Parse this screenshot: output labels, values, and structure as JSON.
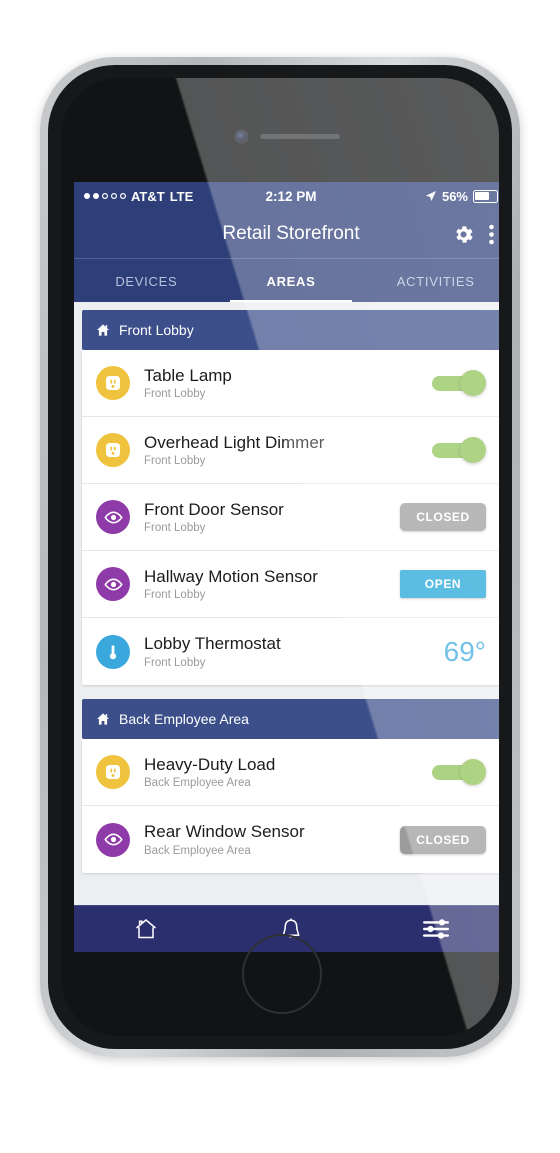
{
  "status_bar": {
    "carrier": "AT&T",
    "network": "LTE",
    "time": "2:12 PM",
    "battery_percent": "56%",
    "signal_filled_dots": 2,
    "signal_hollow_dots": 3,
    "location_icon": "location-arrow-icon",
    "battery_icon": "battery-icon"
  },
  "header": {
    "title": "Retail Storefront",
    "settings_icon": "gear-icon",
    "overflow_icon": "three-dot-menu-icon"
  },
  "tabs": [
    {
      "label": "DEVICES",
      "active": false
    },
    {
      "label": "AREAS",
      "active": true
    },
    {
      "label": "ACTIVITIES",
      "active": false
    }
  ],
  "sections": [
    {
      "title": "Front Lobby",
      "icon": "home-icon",
      "rows": [
        {
          "name": "Table Lamp",
          "area": "Front Lobby",
          "icon": "outlet-icon",
          "icon_color": "#efc33d",
          "control": "toggle",
          "value": "on"
        },
        {
          "name": "Overhead Light Dimmer",
          "area": "Front Lobby",
          "icon": "outlet-icon",
          "icon_color": "#efc33d",
          "control": "toggle",
          "value": "on"
        },
        {
          "name": "Front Door Sensor",
          "area": "Front Lobby",
          "icon": "eye-icon",
          "icon_color": "#8e3aa8",
          "control": "badge-closed",
          "value": "CLOSED"
        },
        {
          "name": "Hallway Motion Sensor",
          "area": "Front Lobby",
          "icon": "eye-icon",
          "icon_color": "#8e3aa8",
          "control": "badge-open",
          "value": "OPEN"
        },
        {
          "name": "Lobby Thermostat",
          "area": "Front Lobby",
          "icon": "thermometer-icon",
          "icon_color": "#3ba8dd",
          "control": "temperature",
          "value": "69°"
        }
      ]
    },
    {
      "title": "Back Employee Area",
      "icon": "home-icon",
      "rows": [
        {
          "name": "Heavy-Duty Load",
          "area": "Back Employee Area",
          "icon": "outlet-icon",
          "icon_color": "#efc33d",
          "control": "toggle",
          "value": "on"
        },
        {
          "name": "Rear Window Sensor",
          "area": "Back Employee Area",
          "icon": "eye-icon",
          "icon_color": "#8e3aa8",
          "control": "badge-closed",
          "value": "CLOSED"
        }
      ]
    }
  ],
  "bottom_nav": [
    {
      "icon": "home-outline-icon"
    },
    {
      "icon": "bell-icon"
    },
    {
      "icon": "sliders-icon"
    }
  ],
  "colors": {
    "header_blue": "#2d3e78",
    "section_blue": "#3c4f8a",
    "toggle_green": "#8cc152",
    "open_blue": "#1ba3d6",
    "closed_gray": "#9b9b9b",
    "temp_blue": "#3ba8dd"
  }
}
